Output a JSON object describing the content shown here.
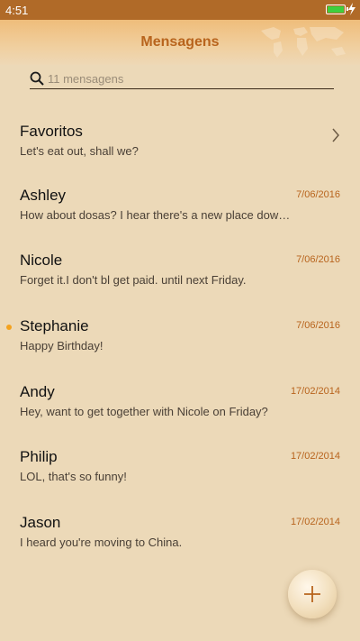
{
  "status_bar": {
    "time": "4:51",
    "battery_color": "#3ecf3e",
    "icons": [
      "battery-charging-icon"
    ]
  },
  "header": {
    "title": "Mensagens",
    "decoration": "world-map-icon"
  },
  "search": {
    "placeholder": "11 mensagens",
    "value": "",
    "icon": "search-icon"
  },
  "conversations": [
    {
      "name": "Favoritos",
      "preview": "Let's eat out, shall we?",
      "date": "",
      "unread": false,
      "chevron": true
    },
    {
      "name": "Ashley",
      "preview": "How about dosas? I hear there's a new place dow…",
      "date": "7/06/2016",
      "unread": false,
      "chevron": false
    },
    {
      "name": "Nicole",
      "preview": "Forget it.I don't bl get paid. until next Friday.",
      "date": "7/06/2016",
      "unread": false,
      "chevron": false
    },
    {
      "name": "Stephanie",
      "preview": "Happy Birthday!",
      "date": "7/06/2016",
      "unread": true,
      "chevron": false
    },
    {
      "name": "Andy",
      "preview": "Hey, want to get together with Nicole on Friday?",
      "date": "17/02/2014",
      "unread": false,
      "chevron": false
    },
    {
      "name": "Philip",
      "preview": "LOL, that's so funny!",
      "date": "17/02/2014",
      "unread": false,
      "chevron": false
    },
    {
      "name": "Jason",
      "preview": "I heard you're moving to China.",
      "date": "17/02/2014",
      "unread": false,
      "chevron": false
    }
  ],
  "fab": {
    "icon": "plus-icon"
  },
  "colors": {
    "accent": "#b8641d",
    "status_bar": "#b06a28",
    "background": "#ecd9b8",
    "unread_dot": "#f4a21e"
  }
}
